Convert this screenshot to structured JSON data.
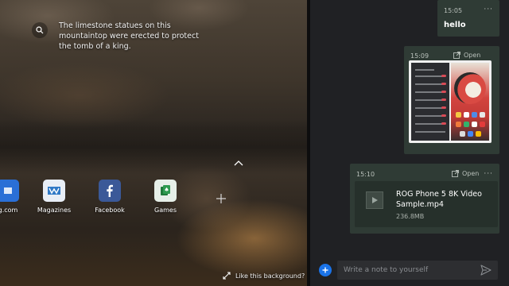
{
  "background": {
    "fact_text": "The limestone statues on this mountaintop were erected to protect the tomb of a king.",
    "like_label": "Like this background?"
  },
  "quick_links": [
    {
      "label": "g.com",
      "icon": "site-icon",
      "color": "#2a6fd6"
    },
    {
      "label": "Magazines",
      "icon": "magazines-icon",
      "color": "#2f79c6"
    },
    {
      "label": "Facebook",
      "icon": "facebook-icon",
      "color": "#3b5998"
    },
    {
      "label": "Games",
      "icon": "games-icon",
      "color": "#1e7a3a"
    }
  ],
  "chat": {
    "messages": [
      {
        "time": "15:05",
        "text": "hello"
      },
      {
        "time": "15:09",
        "open_label": "Open",
        "attachment": "image"
      },
      {
        "time": "15:10",
        "open_label": "Open",
        "file_name": "ROG Phone 5 8K Video Sample.mp4",
        "file_size": "236.8MB"
      }
    ],
    "composer_placeholder": "Write a note to yourself"
  },
  "colors": {
    "bubble": "#2f3b35",
    "accent": "#1a73e8"
  }
}
